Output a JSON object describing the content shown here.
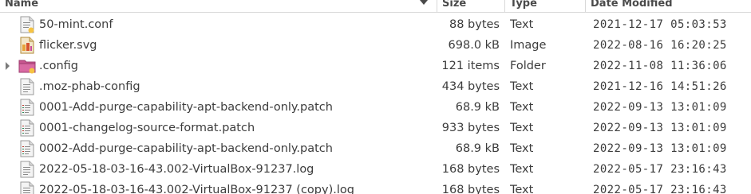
{
  "header": {
    "name": "Name",
    "size": "Size",
    "type": "Type",
    "date": "Date Modified"
  },
  "rows": [
    {
      "name": "50-mint.conf",
      "size": "88 bytes",
      "type": "Text",
      "date": "2021-12-17 05:03:53",
      "icon": "text-file-link-icon"
    },
    {
      "name": "flicker.svg",
      "size": "698.0 kB",
      "type": "Image",
      "date": "2022-08-16 16:20:25",
      "icon": "image-file-icon"
    },
    {
      "name": ".config",
      "size": "121 items",
      "type": "Folder",
      "date": "2022-11-08 11:36:06",
      "icon": "folder-icon"
    },
    {
      "name": ".moz-phab-config",
      "size": "434 bytes",
      "type": "Text",
      "date": "2021-12-16 14:51:26",
      "icon": "text-file-icon"
    },
    {
      "name": "0001-Add-purge-capability-apt-backend-only.patch",
      "size": "68.9 kB",
      "type": "Text",
      "date": "2022-09-13 13:01:09",
      "icon": "patch-file-icon"
    },
    {
      "name": "0001-changelog-source-format.patch",
      "size": "933 bytes",
      "type": "Text",
      "date": "2022-09-13 13:01:09",
      "icon": "patch-file-icon"
    },
    {
      "name": "0002-Add-purge-capability-apt-backend-only.patch",
      "size": "68.9 kB",
      "type": "Text",
      "date": "2022-09-13 13:01:09",
      "icon": "patch-file-icon"
    },
    {
      "name": "2022-05-18-03-16-43.002-VirtualBox-91237.log",
      "size": "168 bytes",
      "type": "Text",
      "date": "2022-05-17 23:16:43",
      "icon": "text-file-icon"
    },
    {
      "name": "2022-05-18-03-16-43.002-VirtualBox-91237 (copy).log",
      "size": "168 bytes",
      "type": "Text",
      "date": "2022-05-17 23:16:43",
      "icon": "text-file-icon"
    }
  ]
}
